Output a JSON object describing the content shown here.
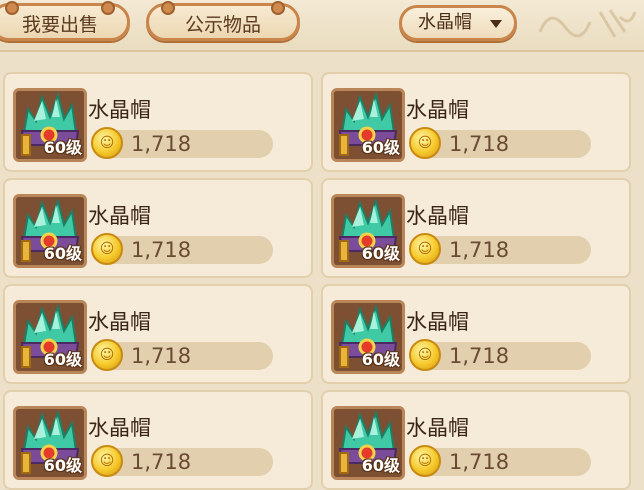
{
  "tabs": {
    "sell_label": "我要出售",
    "public_label": "公示物品"
  },
  "filter": {
    "selected": "水晶帽"
  },
  "listings": [
    {
      "name": "水晶帽",
      "level": "60级",
      "price": "1,718"
    },
    {
      "name": "水晶帽",
      "level": "60级",
      "price": "1,718"
    },
    {
      "name": "水晶帽",
      "level": "60级",
      "price": "1,718"
    },
    {
      "name": "水晶帽",
      "level": "60级",
      "price": "1,718"
    },
    {
      "name": "水晶帽",
      "level": "60级",
      "price": "1,718"
    },
    {
      "name": "水晶帽",
      "level": "60级",
      "price": "1,718"
    },
    {
      "name": "水晶帽",
      "level": "60级",
      "price": "1,718"
    },
    {
      "name": "水晶帽",
      "level": "60级",
      "price": "1,718"
    }
  ],
  "colors": {
    "card_bg": "#f6ebd8",
    "tab_border": "#c9854a",
    "price_bar": "#e1cfae",
    "coin": "#f5c92a"
  }
}
